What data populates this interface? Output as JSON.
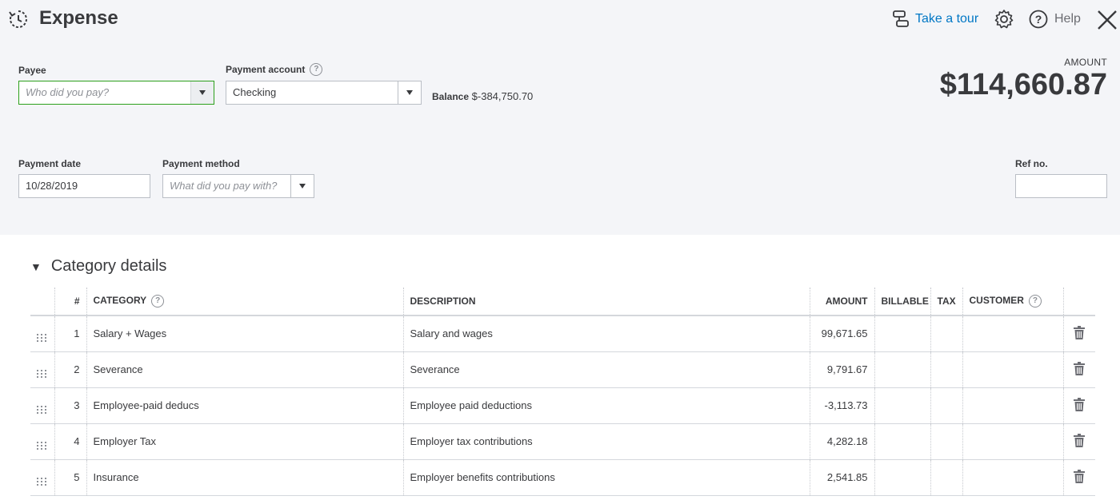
{
  "header": {
    "title": "Expense",
    "tour_label": "Take a tour",
    "help_label": "Help"
  },
  "form": {
    "payee_label": "Payee",
    "payee_placeholder": "Who did you pay?",
    "account_label": "Payment account",
    "account_value": "Checking",
    "balance_label": "Balance",
    "balance_value": "$-384,750.70",
    "amount_label": "AMOUNT",
    "amount_value": "$114,660.87",
    "date_label": "Payment date",
    "date_value": "10/28/2019",
    "method_label": "Payment method",
    "method_placeholder": "What did you pay with?",
    "refno_label": "Ref no.",
    "refno_value": ""
  },
  "category": {
    "heading": "Category details",
    "columns": {
      "num": "#",
      "category": "CATEGORY",
      "description": "DESCRIPTION",
      "amount": "AMOUNT",
      "billable": "BILLABLE",
      "tax": "TAX",
      "customer": "CUSTOMER"
    },
    "rows": [
      {
        "num": "1",
        "category": "Salary + Wages",
        "description": "Salary and wages",
        "amount": "99,671.65"
      },
      {
        "num": "2",
        "category": "Severance",
        "description": "Severance",
        "amount": "9,791.67"
      },
      {
        "num": "3",
        "category": "Employee-paid deducs",
        "description": "Employee paid deductions",
        "amount": "-3,113.73"
      },
      {
        "num": "4",
        "category": "Employer Tax",
        "description": "Employer tax contributions",
        "amount": "4,282.18"
      },
      {
        "num": "5",
        "category": "Insurance",
        "description": "Employer benefits contributions",
        "amount": "2,541.85"
      }
    ]
  },
  "icons": {
    "expense": "expense-icon",
    "tour": "tour-icon",
    "gear": "gear-icon",
    "help": "help-icon",
    "close": "close-icon",
    "drag": "drag-handle-icon",
    "delete": "trash-icon"
  },
  "colors": {
    "accent_link": "#0077c5",
    "payee_focus": "#2ca01c",
    "header_bg": "#f4f5f8"
  }
}
